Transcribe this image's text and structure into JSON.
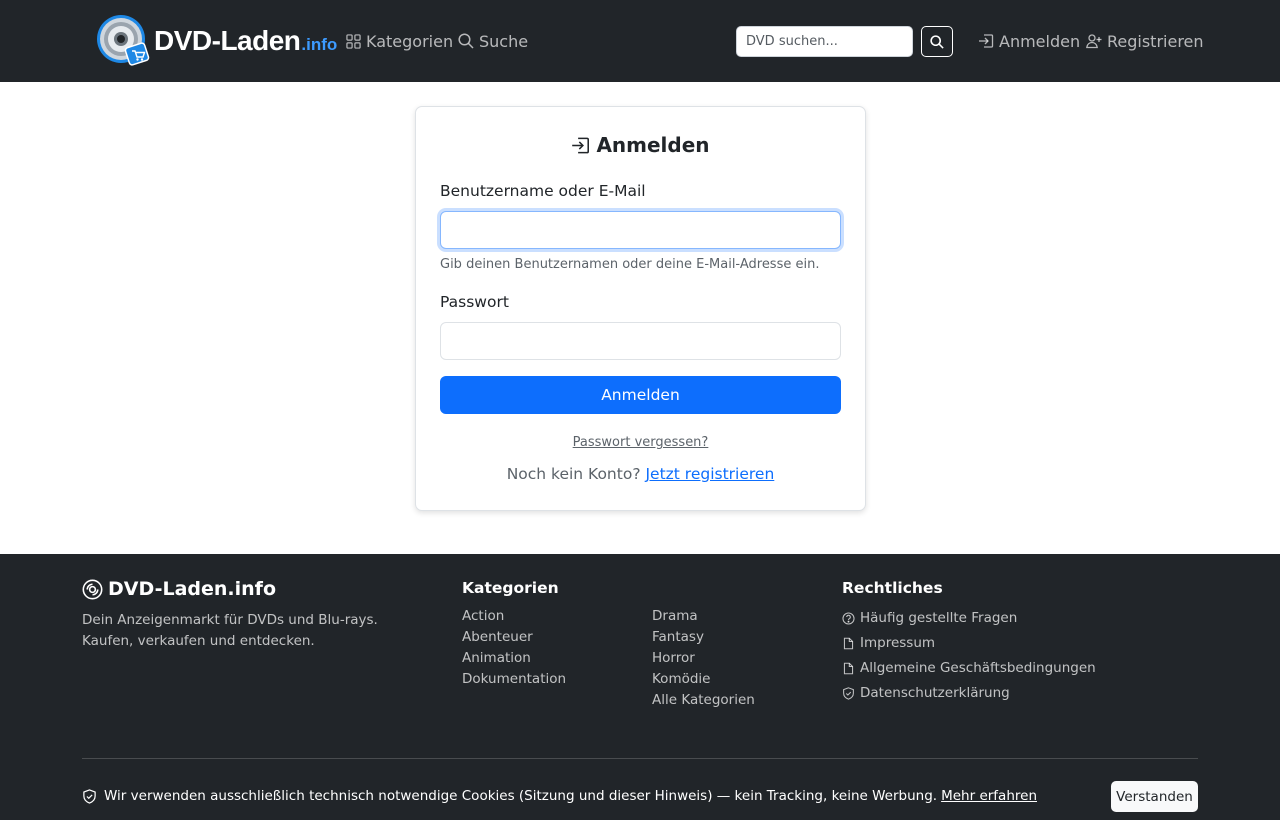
{
  "navbar": {
    "logo_main": "DVD-Laden",
    "logo_suffix": ".info",
    "categories_label": "Kategorien",
    "search_label": "Suche",
    "search_placeholder": "DVD suchen...",
    "login_label": "Anmelden",
    "register_label": "Registrieren"
  },
  "login": {
    "title": "Anmelden",
    "username_label": "Benutzername oder E-Mail",
    "username_value": "",
    "username_hint": "Gib deinen Benutzernamen oder deine E-Mail-Adresse ein.",
    "password_label": "Passwort",
    "password_value": "",
    "submit_label": "Anmelden",
    "forgot_label": "Passwort vergessen?",
    "no_account_text": "Noch kein Konto?",
    "register_link": "Jetzt registrieren"
  },
  "footer": {
    "brand": "DVD-Laden.info",
    "description": "Dein Anzeigenmarkt für DVDs und Blu-rays. Kaufen, verkaufen und entdecken.",
    "categories_heading": "Kategorien",
    "categories_col1": [
      "Action",
      "Abenteuer",
      "Animation",
      "Dokumentation"
    ],
    "categories_col2": [
      "Drama",
      "Fantasy",
      "Horror",
      "Komödie",
      "Alle Kategorien"
    ],
    "legal_heading": "Rechtliches",
    "legal_links": [
      {
        "label": "Häufig gestellte Fragen",
        "icon": "question-circle-icon"
      },
      {
        "label": "Impressum",
        "icon": "file-icon"
      },
      {
        "label": "Allgemeine Geschäftsbedingungen",
        "icon": "file-icon"
      },
      {
        "label": "Datenschutzerklärung",
        "icon": "shield-icon"
      }
    ]
  },
  "cookie": {
    "text": "Wir verwenden ausschließlich technisch notwendige Cookies (Sitzung und dieser Hinweis) — kein Tracking, keine Werbung.",
    "more_link": "Mehr erfahren",
    "accept_label": "Verstanden"
  },
  "colors": {
    "navbar_bg": "#212529",
    "primary": "#0d6efd",
    "logo_accent": "#3d9bff",
    "footer_bg": "#212529"
  }
}
